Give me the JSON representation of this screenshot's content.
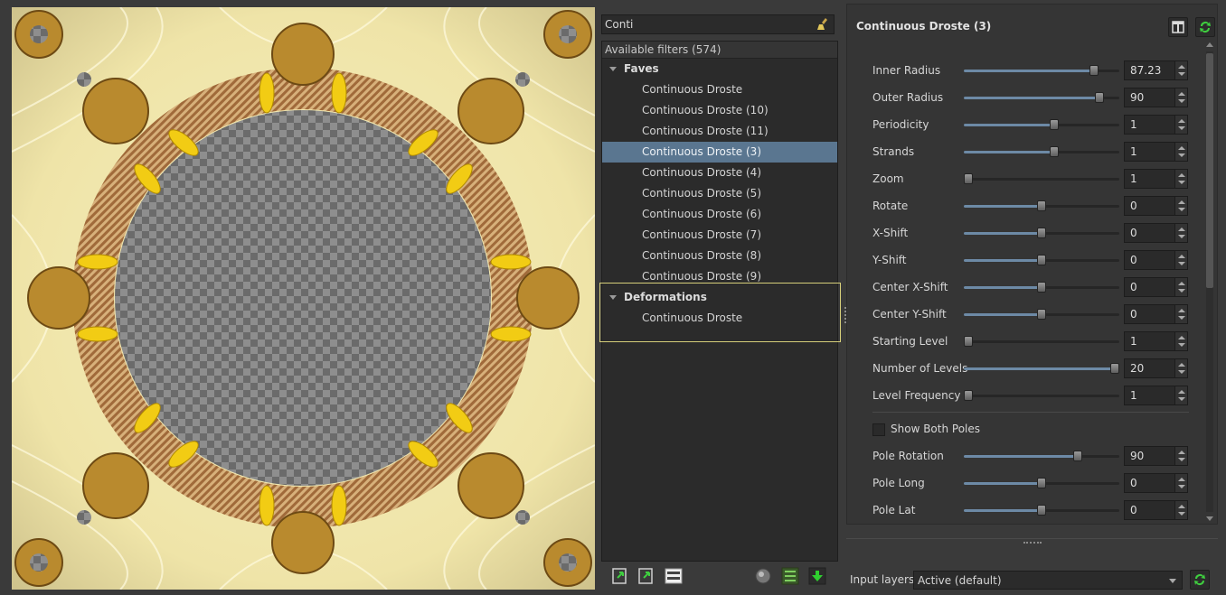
{
  "search": {
    "value": "Conti"
  },
  "filters": {
    "header": "Available filters (574)",
    "categories": [
      {
        "name": "Faves",
        "items": [
          "Continuous Droste",
          "Continuous Droste (10)",
          "Continuous Droste (11)",
          "Continuous Droste (3)",
          "Continuous Droste (4)",
          "Continuous Droste (5)",
          "Continuous Droste (6)",
          "Continuous Droste (7)",
          "Continuous Droste (8)",
          "Continuous Droste (9)"
        ]
      },
      {
        "name": "Deformations",
        "items": [
          "Continuous Droste"
        ]
      }
    ],
    "selected": "Continuous Droste (3)"
  },
  "panel": {
    "title": "Continuous Droste (3)",
    "params": [
      {
        "label": "Inner Radius",
        "value": "87.23",
        "level": 0.84
      },
      {
        "label": "Outer Radius",
        "value": "90",
        "level": 0.87
      },
      {
        "label": "Periodicity",
        "value": "1",
        "level": 0.58
      },
      {
        "label": "Strands",
        "value": "1",
        "level": 0.58
      },
      {
        "label": "Zoom",
        "value": "1",
        "level": 0.03
      },
      {
        "label": "Rotate",
        "value": "0",
        "level": 0.5
      },
      {
        "label": "X-Shift",
        "value": "0",
        "level": 0.5
      },
      {
        "label": "Y-Shift",
        "value": "0",
        "level": 0.5
      },
      {
        "label": "Center X-Shift",
        "value": "0",
        "level": 0.5
      },
      {
        "label": "Center Y-Shift",
        "value": "0",
        "level": 0.5
      },
      {
        "label": "Starting Level",
        "value": "1",
        "level": 0.03
      },
      {
        "label": "Number of Levels",
        "value": "20",
        "level": 0.97
      },
      {
        "label": "Level Frequency",
        "value": "1",
        "level": 0.03
      }
    ],
    "checkbox": {
      "label": "Show Both Poles",
      "checked": false
    },
    "pole_params": [
      {
        "label": "Pole Rotation",
        "value": "90",
        "level": 0.73
      },
      {
        "label": "Pole Long",
        "value": "0",
        "level": 0.5
      },
      {
        "label": "Pole Lat",
        "value": "0",
        "level": 0.5
      }
    ]
  },
  "input_layers": {
    "label": "Input layers",
    "value": "Active (default)"
  },
  "colors": {
    "selection": "#5a7690",
    "slider_fill": "#6d8aa6",
    "highlight_box": "#d6cf7a"
  }
}
